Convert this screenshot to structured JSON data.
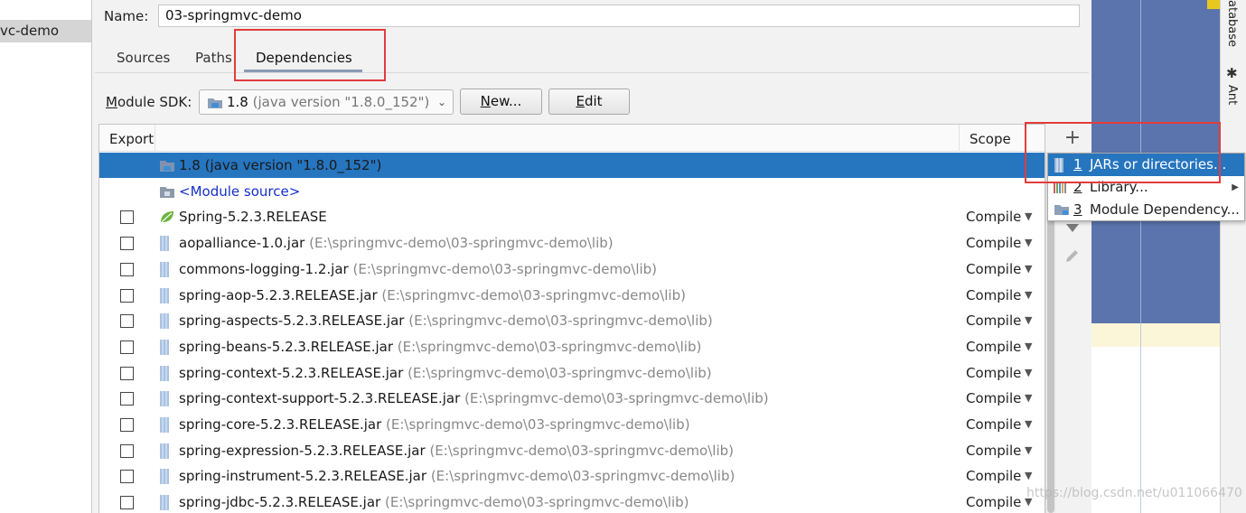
{
  "left_panel": {
    "selected_module": "vc-demo"
  },
  "name_field": {
    "label": "Name:",
    "value": "03-springmvc-demo"
  },
  "tabs": [
    {
      "label": "Sources"
    },
    {
      "label": "Paths"
    },
    {
      "label": "Dependencies",
      "active": true
    }
  ],
  "sdk": {
    "label": "Module SDK:",
    "selected_name": "1.8",
    "selected_detail": "(java version \"1.8.0_152\")",
    "new_label": "New...",
    "edit_label": "Edit"
  },
  "table": {
    "col_export": "Export",
    "col_scope": "Scope",
    "rows": [
      {
        "name": "1.8 (java version \"1.8.0_152\")",
        "path": "",
        "scope": "",
        "kind": "sdk",
        "selected": true
      },
      {
        "name": "<Module source>",
        "path": "",
        "scope": "",
        "kind": "module-source"
      },
      {
        "name": "Spring-5.2.3.RELEASE",
        "path": "",
        "scope": "Compile",
        "kind": "library"
      },
      {
        "name": "aopalliance-1.0.jar",
        "path": "(E:\\springmvc-demo\\03-springmvc-demo\\lib)",
        "scope": "Compile",
        "kind": "jar"
      },
      {
        "name": "commons-logging-1.2.jar",
        "path": "(E:\\springmvc-demo\\03-springmvc-demo\\lib)",
        "scope": "Compile",
        "kind": "jar"
      },
      {
        "name": "spring-aop-5.2.3.RELEASE.jar",
        "path": "(E:\\springmvc-demo\\03-springmvc-demo\\lib)",
        "scope": "Compile",
        "kind": "jar"
      },
      {
        "name": "spring-aspects-5.2.3.RELEASE.jar",
        "path": "(E:\\springmvc-demo\\03-springmvc-demo\\lib)",
        "scope": "Compile",
        "kind": "jar"
      },
      {
        "name": "spring-beans-5.2.3.RELEASE.jar",
        "path": "(E:\\springmvc-demo\\03-springmvc-demo\\lib)",
        "scope": "Compile",
        "kind": "jar"
      },
      {
        "name": "spring-context-5.2.3.RELEASE.jar",
        "path": "(E:\\springmvc-demo\\03-springmvc-demo\\lib)",
        "scope": "Compile",
        "kind": "jar"
      },
      {
        "name": "spring-context-support-5.2.3.RELEASE.jar",
        "path": "(E:\\springmvc-demo\\03-springmvc-demo\\lib)",
        "scope": "Compile",
        "kind": "jar"
      },
      {
        "name": "spring-core-5.2.3.RELEASE.jar",
        "path": "(E:\\springmvc-demo\\03-springmvc-demo\\lib)",
        "scope": "Compile",
        "kind": "jar"
      },
      {
        "name": "spring-expression-5.2.3.RELEASE.jar",
        "path": "(E:\\springmvc-demo\\03-springmvc-demo\\lib)",
        "scope": "Compile",
        "kind": "jar"
      },
      {
        "name": "spring-instrument-5.2.3.RELEASE.jar",
        "path": "(E:\\springmvc-demo\\03-springmvc-demo\\lib)",
        "scope": "Compile",
        "kind": "jar"
      },
      {
        "name": "spring-jdbc-5.2.3.RELEASE.jar",
        "path": "(E:\\springmvc-demo\\03-springmvc-demo\\lib)",
        "scope": "Compile",
        "kind": "jar"
      }
    ]
  },
  "add_menu": {
    "items": [
      {
        "num": "1",
        "label": "JARs or directories...",
        "icon": "jar-icon",
        "active": true
      },
      {
        "num": "2",
        "label": "Library...",
        "icon": "library-icon",
        "submenu": true
      },
      {
        "num": "3",
        "label": "Module Dependency...",
        "icon": "module-folder-icon"
      }
    ]
  },
  "right_strip": {
    "database_tab": "atabase",
    "ant_tab": "Ant"
  },
  "watermark": "https://blog.csdn.net/u011066470",
  "colors": {
    "selection": "#2675bf",
    "highlight_box": "#e23c3c",
    "editor_blue": "#5b74ad"
  }
}
